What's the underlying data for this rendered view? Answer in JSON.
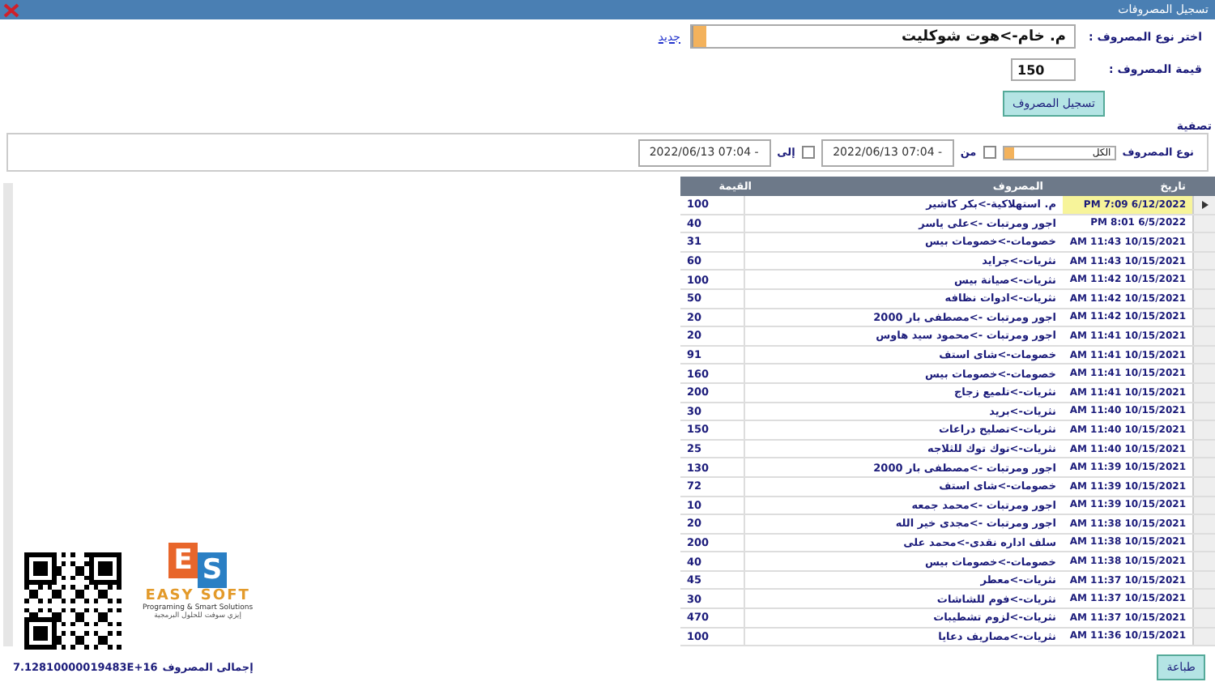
{
  "window": {
    "title": "تسجيل المصروفات"
  },
  "expense_type": {
    "label": "اختر نوع المصروف :",
    "value": "م. خام->هوت شوكليت",
    "new_link": "جديد"
  },
  "amount": {
    "label": "قيمة المصروف :",
    "value": "150"
  },
  "submit_button": "تسجيل المصروف",
  "filter": {
    "title": "تصفية",
    "type_label": "نوع المصروف",
    "type_value": "الكل",
    "from_checked": false,
    "from_label": "من",
    "from_value": "2022/06/13 07:04 -",
    "to_checked": false,
    "to_label": "إلى",
    "to_value": "2022/06/13 07:04 -"
  },
  "table": {
    "columns": [
      "تاريخ",
      "المصروف",
      "القيمة"
    ],
    "rows": [
      {
        "date": "PM 7:09 6/12/2022",
        "expense": "م. استهلاكية->بكر كاشير",
        "value": "100",
        "selected": true
      },
      {
        "date": "PM 8:01 6/5/2022",
        "expense": "اجور ومرتبات ->على ياسر",
        "value": "40",
        "selected": false
      },
      {
        "date": "AM 11:43 10/15/2021",
        "expense": "خصومات->خصومات بيس",
        "value": "31",
        "selected": false
      },
      {
        "date": "AM 11:43 10/15/2021",
        "expense": "نثريات->جرايد",
        "value": "60",
        "selected": false
      },
      {
        "date": "AM 11:42 10/15/2021",
        "expense": "نثريات->صيانة بيس",
        "value": "100",
        "selected": false
      },
      {
        "date": "AM 11:42 10/15/2021",
        "expense": "نثريات->ادوات نظافه",
        "value": "50",
        "selected": false
      },
      {
        "date": "AM 11:42 10/15/2021",
        "expense": "اجور ومرتبات ->مصطفى بار 2000",
        "value": "20",
        "selected": false
      },
      {
        "date": "AM 11:41 10/15/2021",
        "expense": "اجور ومرتبات ->محمود سيد هاوس",
        "value": "20",
        "selected": false
      },
      {
        "date": "AM 11:41 10/15/2021",
        "expense": "خصومات->شاى استف",
        "value": "91",
        "selected": false
      },
      {
        "date": "AM 11:41 10/15/2021",
        "expense": "خصومات->خصومات بيس",
        "value": "160",
        "selected": false
      },
      {
        "date": "AM 11:41 10/15/2021",
        "expense": "نثريات->تلميع زجاج",
        "value": "200",
        "selected": false
      },
      {
        "date": "AM 11:40 10/15/2021",
        "expense": "نثريات->بريد",
        "value": "30",
        "selected": false
      },
      {
        "date": "AM 11:40 10/15/2021",
        "expense": "نثريات->تصليح دراعات",
        "value": "150",
        "selected": false
      },
      {
        "date": "AM 11:40 10/15/2021",
        "expense": "نثريات->توك توك للثلاجه",
        "value": "25",
        "selected": false
      },
      {
        "date": "AM 11:39 10/15/2021",
        "expense": "اجور ومرتبات ->مصطفى بار 2000",
        "value": "130",
        "selected": false
      },
      {
        "date": "AM 11:39 10/15/2021",
        "expense": "خصومات->شاى استف",
        "value": "72",
        "selected": false
      },
      {
        "date": "AM 11:39 10/15/2021",
        "expense": "اجور ومرتبات ->محمد جمعه",
        "value": "10",
        "selected": false
      },
      {
        "date": "AM 11:38 10/15/2021",
        "expense": "اجور ومرتبات ->مجدى خير الله",
        "value": "20",
        "selected": false
      },
      {
        "date": "AM 11:38 10/15/2021",
        "expense": "سلف اداره نقدى->محمد على",
        "value": "200",
        "selected": false
      },
      {
        "date": "AM 11:38 10/15/2021",
        "expense": "خصومات->خصومات بيس",
        "value": "40",
        "selected": false
      },
      {
        "date": "AM 11:37 10/15/2021",
        "expense": "نثريات->معطر",
        "value": "45",
        "selected": false
      },
      {
        "date": "AM 11:37 10/15/2021",
        "expense": "نثريات->فوم للشاشات",
        "value": "30",
        "selected": false
      },
      {
        "date": "AM 11:37 10/15/2021",
        "expense": "نثريات->لزوم تشطيبات",
        "value": "470",
        "selected": false
      },
      {
        "date": "AM 11:36 10/15/2021",
        "expense": "نثريات->مصاريف دعايا",
        "value": "100",
        "selected": false
      }
    ]
  },
  "logo": {
    "letter_left": "E",
    "letter_right": "S",
    "name": "EASY SOFT",
    "tagline": "Programing & Smart Solutions",
    "arabic_tagline": "إيزي سوفت للحلول البرمجية"
  },
  "total": {
    "label": "إجمالى المصروف",
    "value": "7.12810000019483E+16"
  },
  "print_button": "طباعة"
}
